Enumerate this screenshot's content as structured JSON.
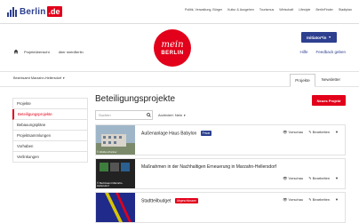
{
  "brand": {
    "logo_text": "Berlin",
    "logo_suffix": ".de",
    "center_logo_script": "mein",
    "center_logo_word": "BERLIN"
  },
  "top_nav": [
    "Politik, Verwaltung, Bürger",
    "Kultur & Ausgehen",
    "Tourismus",
    "Wirtschaft",
    "Lifestyle",
    "BerlinFinder",
    "Stadtplan"
  ],
  "header": {
    "breadcrumbs": [
      "Projektübersicht",
      "über meinBerlin"
    ],
    "initiator_button": "Initiator*in",
    "links": [
      "Hilfe",
      "Feedback geben"
    ]
  },
  "orgbar": {
    "organization": "Bezirksamt Marzahn-Hellersdorf",
    "tabs": [
      {
        "label": "Projekte",
        "active": true
      },
      {
        "label": "Newsletter",
        "active": false
      }
    ]
  },
  "sidebar": {
    "items": [
      {
        "label": "Projekte",
        "active": false
      },
      {
        "label": "Beteiligungsprojekte",
        "active": true
      },
      {
        "label": "Bebauungspläne",
        "active": false
      },
      {
        "label": "Projektsammlungen",
        "active": false
      },
      {
        "label": "Vorhaben",
        "active": false
      },
      {
        "label": "Verlinkungen",
        "active": false
      }
    ]
  },
  "main": {
    "title": "Beteiligungsprojekte",
    "new_project_button": "Neues Projekt",
    "search_placeholder": "Suchen",
    "archived_filter": "Archiviert: Nein",
    "projects": [
      {
        "title": "Außenanlage Haus Babylon",
        "badge": "Privat",
        "badge_color": "#2b3f8f",
        "caption": "© Weißen-Partner",
        "preview": "Vorschau",
        "edit": "Bearbeiten"
      },
      {
        "title": "Maßnahmen in der Nachhaltigen Erneuerung in Marzahn-Hellersdorf",
        "badge": "",
        "badge_color": "",
        "caption": "© Bezirksamt Marzahn-Hellersdorf",
        "preview": "Vorschau",
        "edit": "Bearbeiten"
      },
      {
        "title": "Stadtteilbudget",
        "badge": "Abgeschlossen",
        "badge_color": "#e2001a",
        "caption": "",
        "preview": "Vorschau",
        "edit": "Bearbeiten"
      }
    ]
  },
  "colors": {
    "accent_red": "#e2001a",
    "brand_blue": "#2b3f8f"
  }
}
